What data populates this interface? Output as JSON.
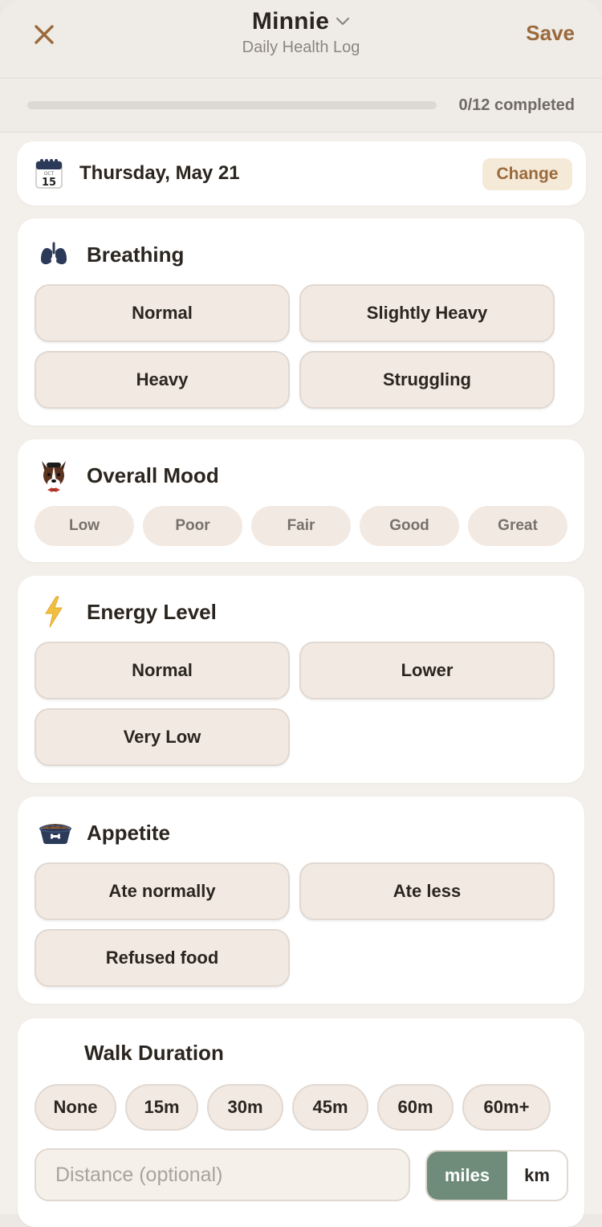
{
  "header": {
    "title": "Minnie",
    "subtitle": "Daily Health Log",
    "save_label": "Save"
  },
  "progress": {
    "completed": 0,
    "total": 12,
    "label": "0/12 completed"
  },
  "date": {
    "calendar_month": "OCT",
    "calendar_day": "15",
    "label": "Thursday, May 21",
    "change_label": "Change"
  },
  "breathing": {
    "title": "Breathing",
    "options": [
      "Normal",
      "Slightly Heavy",
      "Heavy",
      "Struggling"
    ]
  },
  "mood": {
    "title": "Overall Mood",
    "options": [
      "Low",
      "Poor",
      "Fair",
      "Good",
      "Great"
    ]
  },
  "energy": {
    "title": "Energy Level",
    "options": [
      "Normal",
      "Lower",
      "Very Low"
    ]
  },
  "appetite": {
    "title": "Appetite",
    "options": [
      "Ate normally",
      "Ate less",
      "Refused food"
    ]
  },
  "walk": {
    "title": "Walk Duration",
    "options": [
      "None",
      "15m",
      "30m",
      "45m",
      "60m",
      "60m+"
    ],
    "distance_placeholder": "Distance (optional)",
    "units": [
      "miles",
      "km"
    ],
    "selected_unit": "miles"
  },
  "colors": {
    "accent": "#9a6a3c",
    "unit_active": "#6e8c79",
    "option_bg": "#f2e9e2",
    "background": "#f3efea"
  }
}
